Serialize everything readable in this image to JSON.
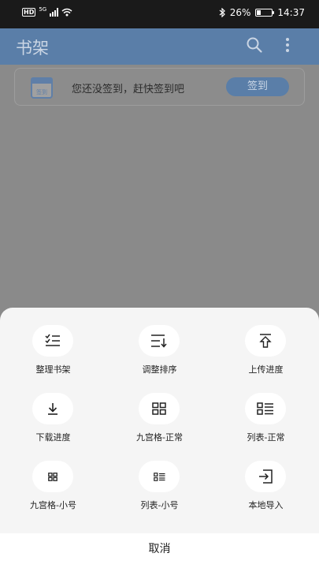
{
  "status_bar": {
    "network": "HD",
    "signal_label": "5G",
    "battery_pct": "26%",
    "time": "14:37",
    "battery_level": 0.26
  },
  "app_bar": {
    "title": "书架",
    "icons": [
      "search-icon",
      "more-vert-icon"
    ]
  },
  "sign_banner": {
    "calendar_text": "签到",
    "message": "您还没签到，赶快签到吧",
    "button": "签到"
  },
  "sheet": {
    "items": [
      {
        "label": "整理书架",
        "icon": "manage-shelf-icon"
      },
      {
        "label": "调整排序",
        "icon": "sort-icon"
      },
      {
        "label": "上传进度",
        "icon": "upload-progress-icon"
      },
      {
        "label": "下载进度",
        "icon": "download-progress-icon"
      },
      {
        "label": "九宫格-正常",
        "icon": "grid-normal-icon"
      },
      {
        "label": "列表-正常",
        "icon": "list-normal-icon"
      },
      {
        "label": "九宫格-小号",
        "icon": "grid-small-icon"
      },
      {
        "label": "列表-小号",
        "icon": "list-small-icon"
      },
      {
        "label": "本地导入",
        "icon": "local-import-icon"
      }
    ],
    "cancel": "取消"
  },
  "colors": {
    "accent": "#5a7ea8",
    "overlay_bg": "#8a8a8a",
    "sheet_bg": "#f5f5f5"
  }
}
